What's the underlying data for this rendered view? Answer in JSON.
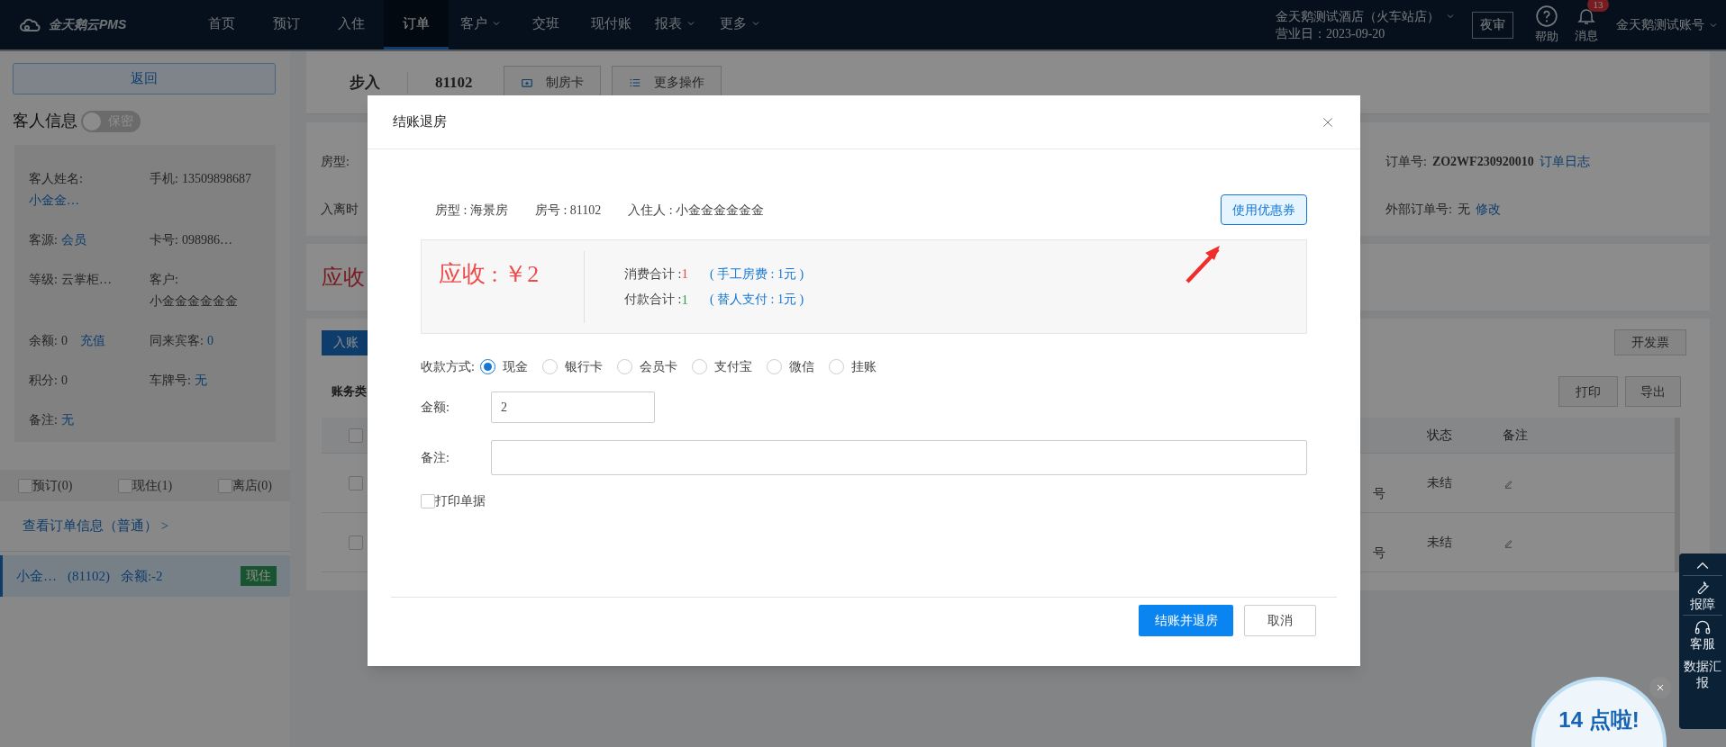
{
  "nav": {
    "logo": "金天鹅云PMS",
    "items": [
      {
        "label": "首页",
        "selected": false,
        "dropdown": false
      },
      {
        "label": "预订",
        "selected": false,
        "dropdown": false
      },
      {
        "label": "入住",
        "selected": false,
        "dropdown": false
      },
      {
        "label": "订单",
        "selected": true,
        "dropdown": false
      },
      {
        "label": "客户",
        "selected": false,
        "dropdown": true
      },
      {
        "label": "交班",
        "selected": false,
        "dropdown": false
      },
      {
        "label": "现付账",
        "selected": false,
        "dropdown": false
      },
      {
        "label": "报表",
        "selected": false,
        "dropdown": true
      },
      {
        "label": "更多",
        "selected": false,
        "dropdown": true
      }
    ],
    "hotel": "金天鹅测试酒店（火车站店）",
    "business_day": "营业日：2023-09-20",
    "night_audit": "夜审",
    "help": "帮助",
    "messages": "消息",
    "message_count": "13",
    "account": "金天鹅测试账号"
  },
  "sidebar": {
    "back": "返回",
    "guest_title": "客人信息",
    "privacy_toggle": {
      "label": "保密",
      "on": false
    },
    "fields": [
      {
        "kind": "stacked",
        "label": "客人姓名:",
        "value": "小金金…",
        "link": true
      },
      {
        "kind": "inline",
        "label": "手机:",
        "value": "13509898687",
        "link": false
      },
      {
        "kind": "inline",
        "label": "客源:",
        "value": "会员",
        "link": true
      },
      {
        "kind": "inline",
        "label": "卡号:",
        "value": "098986…",
        "link": false
      },
      {
        "kind": "inline",
        "label": "等级:",
        "value": "云掌柜…",
        "link": false
      },
      {
        "kind": "inline",
        "label": "客户:",
        "value": "小金金金金金金",
        "link": false
      },
      {
        "kind": "inline",
        "label": "余额:",
        "value": "0",
        "link": false,
        "action": "充值"
      },
      {
        "kind": "inline",
        "label": "同来宾客:",
        "value": "0",
        "link": true
      },
      {
        "kind": "inline",
        "label": "积分:",
        "value": "0",
        "link": false
      },
      {
        "kind": "inline",
        "label": "车牌号:",
        "value": "无",
        "link": true
      },
      {
        "kind": "inline",
        "label": "备注:",
        "value": "无",
        "link": true
      }
    ],
    "filters": [
      {
        "label": "预订(0)",
        "checked": false
      },
      {
        "label": "现住(1)",
        "checked": false
      },
      {
        "label": "离店(0)",
        "checked": false
      }
    ],
    "order_link": "查看订单信息（普通） >",
    "rooms": [
      {
        "name": "小金…",
        "room": "(81102)",
        "balance": "余额:-2",
        "status": "现住",
        "selected": true
      }
    ]
  },
  "order": {
    "title": "步入",
    "room": "81102",
    "actions": [
      "制房卡",
      "更多操作"
    ],
    "room_type_label": "房型:",
    "time_label": "入离时",
    "receivable": "应收",
    "order_no_label": "订单号:",
    "order_no": "ZO2WF230920010",
    "order_log": "订单日志",
    "ext_label": "外部订单号:",
    "ext_value": "无",
    "ext_edit": "修改"
  },
  "ledger": {
    "post_button": "入账",
    "invoice": "开发票",
    "print": "打印",
    "export": "导出",
    "type_label": "账务类",
    "header_checked": false,
    "columns": [
      "状态",
      "备注"
    ],
    "rows": [
      {
        "column_1": "号",
        "status": "未结",
        "checked": false
      },
      {
        "column_1": "号",
        "status": "未结",
        "checked": false
      }
    ]
  },
  "dialog": {
    "title": "结账退房",
    "info": [
      "房型 : 海景房",
      "房号 : 81102",
      "入住人 : 小金金金金金金"
    ],
    "coupon_button": "使用优惠券",
    "receivable": "应收 : ￥2",
    "totals": [
      {
        "label": "消费合计 : ",
        "value": "1",
        "color": "#e94b4b",
        "detail": "( 手工房费 : 1元 )"
      },
      {
        "label": "付款合计 : ",
        "value": "1",
        "color": "#2ea44f",
        "detail": "( 替人支付 : 1元 )"
      }
    ],
    "payment_label": "收款方式:",
    "methods": [
      {
        "label": "现金",
        "selected": true
      },
      {
        "label": "银行卡",
        "selected": false
      },
      {
        "label": "会员卡",
        "selected": false
      },
      {
        "label": "支付宝",
        "selected": false
      },
      {
        "label": "微信",
        "selected": false
      },
      {
        "label": "挂账",
        "selected": false
      }
    ],
    "amount_label": "金额:",
    "amount": "2",
    "remark_label": "备注:",
    "print_receipt": {
      "label": "打印单据",
      "checked": false
    },
    "confirm": "结账并退房",
    "cancel": "取消"
  },
  "float_panel": {
    "items": [
      "报障",
      "客服",
      "数据汇报"
    ]
  },
  "reminder": {
    "text": "14 点啦!"
  }
}
